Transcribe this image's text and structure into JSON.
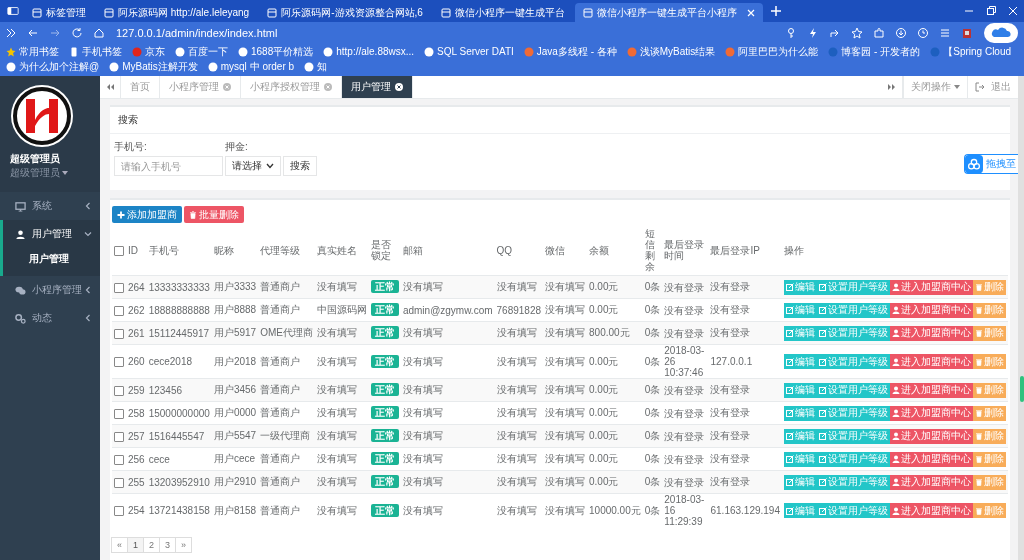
{
  "browser": {
    "tabs": [
      {
        "title": "标签管理",
        "selected": false
      },
      {
        "title": "阿乐源码网 http://ale.leleyang",
        "selected": false
      },
      {
        "title": "阿乐源码网-游戏资源整合网站,6",
        "selected": false
      },
      {
        "title": "微信小程序一键生成平台",
        "selected": false
      },
      {
        "title": "微信小程序一键生成平台小程序",
        "selected": true
      }
    ],
    "address": "127.0.0.1/admin/index/index.html",
    "bookmarks": [
      "常用书签",
      "手机书签",
      "京东",
      "百度一下",
      "1688平价精选",
      "http://ale.88wsx...",
      "SQL Server DATI",
      "Java多线程 - 各种",
      "浅谈MyBatis结果",
      "阿里巴巴为什么能",
      "博客园 - 开发者的",
      "【Spring Cloud",
      "为什么加个注解@",
      "MyBatis注解开发",
      "mysql 中 order b",
      "知"
    ]
  },
  "sidebar": {
    "user_name": "超级管理员",
    "role": "超级管理员",
    "menu": [
      {
        "label": "系统",
        "expanded": false,
        "selected": false
      },
      {
        "label": "用户管理",
        "expanded": true,
        "selected": true,
        "children": [
          {
            "label": "用户管理",
            "selected": true
          }
        ]
      },
      {
        "label": "小程序管理",
        "expanded": false,
        "selected": false
      },
      {
        "label": "动态",
        "expanded": false,
        "selected": false
      }
    ]
  },
  "page_tabs": [
    {
      "label": "首页",
      "selected": false,
      "closable": false
    },
    {
      "label": "小程序管理",
      "selected": false,
      "closable": true
    },
    {
      "label": "小程序授权管理",
      "selected": false,
      "closable": true
    },
    {
      "label": "用户管理",
      "selected": true,
      "closable": true
    }
  ],
  "page_actions": {
    "close_menu": "关闭操作",
    "logout": "退出"
  },
  "search": {
    "title": "搜索",
    "phone_label": "手机号:",
    "phone_placeholder": "请输入手机号",
    "deposit_label": "押金:",
    "deposit_value": "请选择",
    "button": "搜索"
  },
  "float_widget": "拖拽至",
  "table": {
    "add_button": "添加加盟商",
    "delete_button": "批量删除",
    "all_checked": false,
    "columns": [
      "ID",
      "手机号",
      "昵称",
      "代理等级",
      "真实姓名",
      "是否锁定",
      "邮箱",
      "QQ",
      "微信",
      "余额",
      "短信剩余",
      "最后登录时间",
      "最后登录IP",
      "操作"
    ],
    "rows": [
      {
        "checked": false,
        "cells": [
          "264",
          "13333333333",
          "用户3333",
          "普通商户",
          "没有填写",
          "正常",
          "没有填写",
          "没有填写",
          "没有填写",
          "0.00元",
          "0条",
          "没有登录",
          "没有登录"
        ],
        "actions": [
          "编辑",
          "设置用户等级",
          "进入加盟商中心",
          "删除"
        ]
      },
      {
        "checked": false,
        "cells": [
          "262",
          "18888888888",
          "用户8888",
          "普通商户",
          "中国源码网",
          "正常",
          "admin@zgymw.com",
          "76891828",
          "没有填写",
          "0.00元",
          "0条",
          "没有登录",
          "没有登录"
        ],
        "actions": [
          "编辑",
          "设置用户等级",
          "进入加盟商中心",
          "删除"
        ]
      },
      {
        "checked": false,
        "cells": [
          "261",
          "15112445917",
          "用户5917",
          "OME代理商",
          "没有填写",
          "正常",
          "没有填写",
          "没有填写",
          "没有填写",
          "800.00元",
          "0条",
          "没有登录",
          "没有登录"
        ],
        "actions": [
          "编辑",
          "设置用户等级",
          "进入加盟商中心",
          "删除"
        ]
      },
      {
        "checked": false,
        "cells": [
          "260",
          "cece2018",
          "用户2018",
          "普通商户",
          "没有填写",
          "正常",
          "没有填写",
          "没有填写",
          "没有填写",
          "0.00元",
          "0条",
          "2018-03-26 10:37:46",
          "127.0.0.1"
        ],
        "actions": [
          "编辑",
          "设置用户等级",
          "进入加盟商中心",
          "删除"
        ]
      },
      {
        "checked": false,
        "cells": [
          "259",
          "123456",
          "用户3456",
          "普通商户",
          "没有填写",
          "正常",
          "没有填写",
          "没有填写",
          "没有填写",
          "0.00元",
          "0条",
          "没有登录",
          "没有登录"
        ],
        "actions": [
          "编辑",
          "设置用户等级",
          "进入加盟商中心",
          "删除"
        ]
      },
      {
        "checked": false,
        "cells": [
          "258",
          "15000000000",
          "用户0000",
          "普通商户",
          "没有填写",
          "正常",
          "没有填写",
          "没有填写",
          "没有填写",
          "0.00元",
          "0条",
          "没有登录",
          "没有登录"
        ],
        "actions": [
          "编辑",
          "设置用户等级",
          "进入加盟商中心",
          "删除"
        ]
      },
      {
        "checked": false,
        "cells": [
          "257",
          "1516445547",
          "用户5547",
          "一级代理商",
          "没有填写",
          "正常",
          "没有填写",
          "没有填写",
          "没有填写",
          "0.00元",
          "0条",
          "没有登录",
          "没有登录"
        ],
        "actions": [
          "编辑",
          "设置用户等级",
          "进入加盟商中心",
          "删除"
        ]
      },
      {
        "checked": false,
        "cells": [
          "256",
          "cece",
          "用户cece",
          "普通商户",
          "没有填写",
          "正常",
          "没有填写",
          "没有填写",
          "没有填写",
          "0.00元",
          "0条",
          "没有登录",
          "没有登录"
        ],
        "actions": [
          "编辑",
          "设置用户等级",
          "进入加盟商中心",
          "删除"
        ]
      },
      {
        "checked": false,
        "cells": [
          "255",
          "13203952910",
          "用户2910",
          "普通商户",
          "没有填写",
          "正常",
          "没有填写",
          "没有填写",
          "没有填写",
          "0.00元",
          "0条",
          "没有登录",
          "没有登录"
        ],
        "actions": [
          "编辑",
          "设置用户等级",
          "进入加盟商中心",
          "删除"
        ]
      },
      {
        "checked": false,
        "cells": [
          "254",
          "13721438158",
          "用户8158",
          "普通商户",
          "没有填写",
          "正常",
          "没有填写",
          "没有填写",
          "没有填写",
          "10000.00元",
          "0条",
          "2018-03-16 11:29:39",
          "61.163.129.194"
        ],
        "actions": [
          "编辑",
          "设置用户等级",
          "进入加盟商中心",
          "删除"
        ]
      }
    ]
  },
  "pagination": [
    {
      "label": "«",
      "selected": false
    },
    {
      "label": "1",
      "selected": true
    },
    {
      "label": "2",
      "selected": false
    },
    {
      "label": "3",
      "selected": false
    },
    {
      "label": "»",
      "selected": false
    }
  ]
}
